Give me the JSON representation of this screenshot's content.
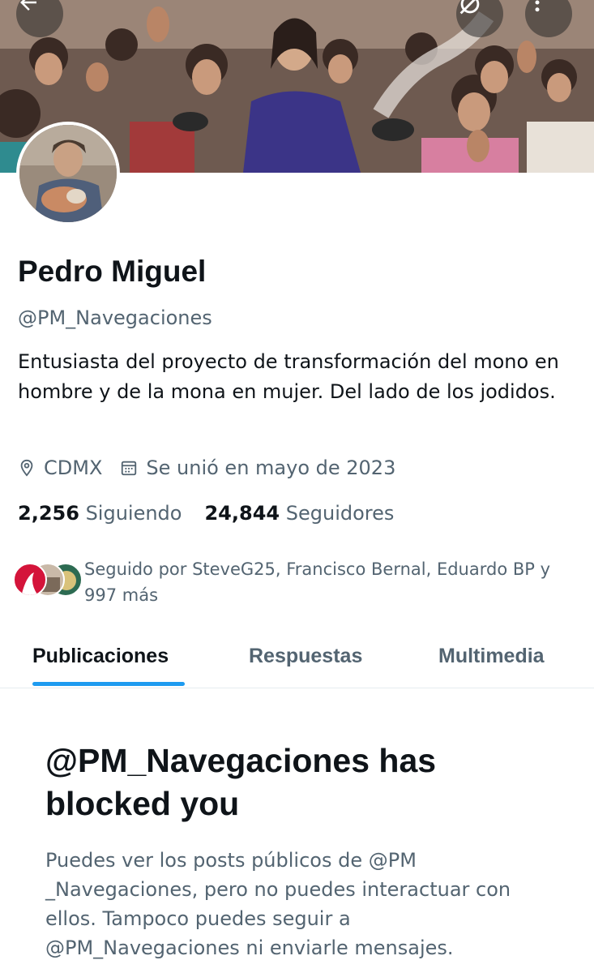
{
  "header": {
    "back_icon": "arrow-left-icon",
    "hide_icon": "eye-slash-icon",
    "more_icon": "more-vertical-icon"
  },
  "profile": {
    "name": "Pedro Miguel",
    "handle": "@PM_Navegaciones",
    "bio": "Entusiasta del proyecto de transformación del mono en hombre y de la mona en mujer. Del lado de los jodidos.",
    "location": "CDMX",
    "joined": "Se unió en mayo de 2023",
    "following_count": "2,256",
    "following_label": "Siguiendo",
    "followers_count": "24,844",
    "followers_label": "Seguidores",
    "followed_by": "Seguido por SteveG25, Francisco Bernal, Eduardo BP y 997 más"
  },
  "tabs": [
    {
      "label": "Publicaciones",
      "active": true
    },
    {
      "label": "Respuestas",
      "active": false
    },
    {
      "label": "Multimedia",
      "active": false
    }
  ],
  "blocked": {
    "title": "@PM_Navegaciones has blocked you",
    "body": "Puedes ver los posts públicos de @PM _Navegaciones, pero no puedes interactuar con ellos. Tampoco puedes seguir a @PM_Navegaciones ni enviarle mensajes."
  },
  "colors": {
    "accent": "#1d9bf0",
    "text_primary": "#0f1419",
    "text_secondary": "#536471"
  }
}
